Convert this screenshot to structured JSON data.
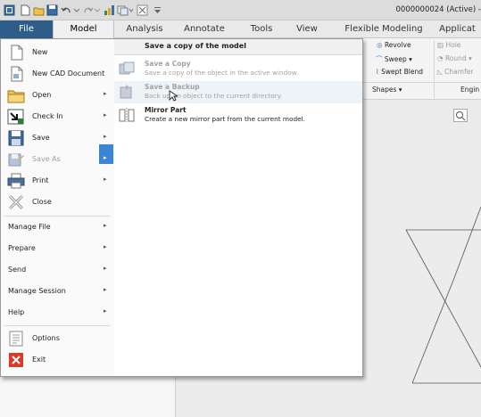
{
  "window": {
    "title": "0000000024 (Active) -"
  },
  "ribbon": {
    "tabs": [
      "File",
      "Model",
      "Analysis",
      "Annotate",
      "Tools",
      "View",
      "Flexible Modeling",
      "Applicat"
    ],
    "shapes": {
      "revolve": "Revolve",
      "sweep": "Sweep",
      "swept_blend": "Swept Blend",
      "group_label": "Shapes"
    },
    "engineering": {
      "hole": "Hole",
      "round": "Round",
      "chamfer": "Chamfer",
      "group_label": "Engin"
    }
  },
  "file_menu": {
    "items": [
      {
        "label": "New",
        "disabled": false,
        "has_submenu": false
      },
      {
        "label": "New CAD Document",
        "disabled": false,
        "has_submenu": false
      },
      {
        "label": "Open",
        "disabled": false,
        "has_submenu": true
      },
      {
        "label": "Check In",
        "disabled": false,
        "has_submenu": true
      },
      {
        "label": "Save",
        "disabled": false,
        "has_submenu": true
      },
      {
        "label": "Save As",
        "disabled": true,
        "has_submenu": true
      },
      {
        "label": "Print",
        "disabled": false,
        "has_submenu": true
      },
      {
        "label": "Close",
        "disabled": false,
        "has_submenu": false
      }
    ],
    "secondary": [
      {
        "label": "Manage File"
      },
      {
        "label": "Prepare"
      },
      {
        "label": "Send"
      },
      {
        "label": "Manage Session"
      },
      {
        "label": "Help"
      }
    ],
    "bottom": [
      {
        "label": "Options"
      },
      {
        "label": "Exit"
      }
    ]
  },
  "save_as_submenu": {
    "header": "Save a copy of the model",
    "items": [
      {
        "title": "Save a Copy",
        "desc": "Save a copy of the object in the active window.",
        "disabled": true
      },
      {
        "title": "Save a Backup",
        "desc": "Back up an object to the current directory.",
        "disabled": true
      },
      {
        "title": "Mirror Part",
        "desc": "Create a new mirror part from the current model.",
        "disabled": false
      }
    ]
  },
  "colors": {
    "file_tab": "#2e5d8a",
    "highlight": "#3a86d6",
    "exit_red": "#d93a2b"
  }
}
